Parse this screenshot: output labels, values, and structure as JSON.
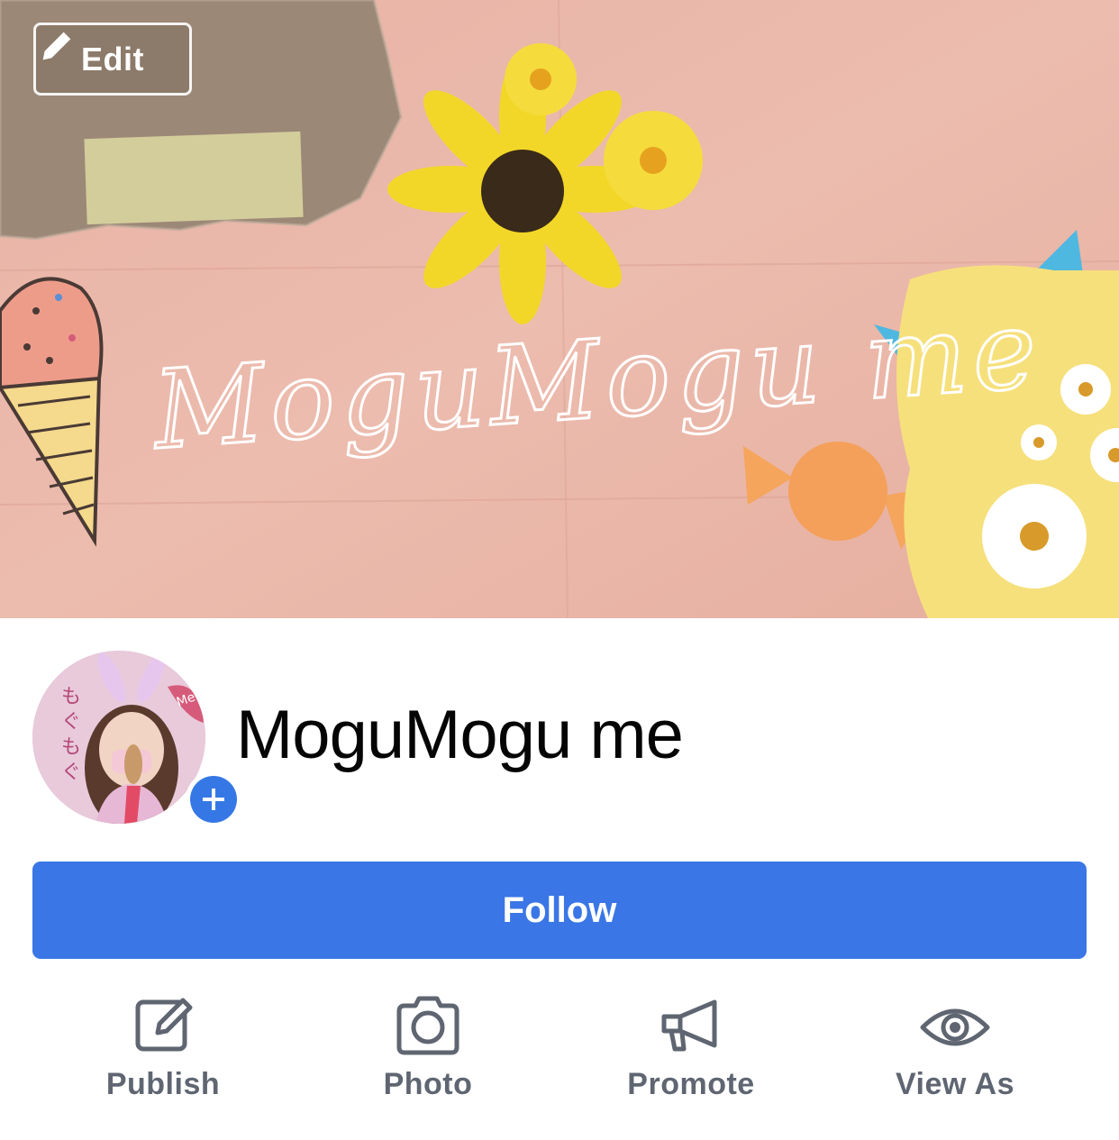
{
  "cover": {
    "edit_label": "Edit",
    "script_text": "MoguMogu me"
  },
  "page": {
    "name": "MoguMogu me"
  },
  "avatar": {
    "side_text": [
      "も",
      "ぐ",
      "も",
      "ぐ"
    ],
    "badge_text": "Me"
  },
  "follow": {
    "label": "Follow"
  },
  "actions": [
    {
      "label": "Publish",
      "icon": "publish-icon"
    },
    {
      "label": "Photo",
      "icon": "camera-icon"
    },
    {
      "label": "Promote",
      "icon": "megaphone-icon"
    },
    {
      "label": "View As",
      "icon": "eye-icon"
    }
  ],
  "colors": {
    "accent": "#3a76e6",
    "action_text": "#5f6672",
    "cover_base": "#e9b4a7"
  }
}
